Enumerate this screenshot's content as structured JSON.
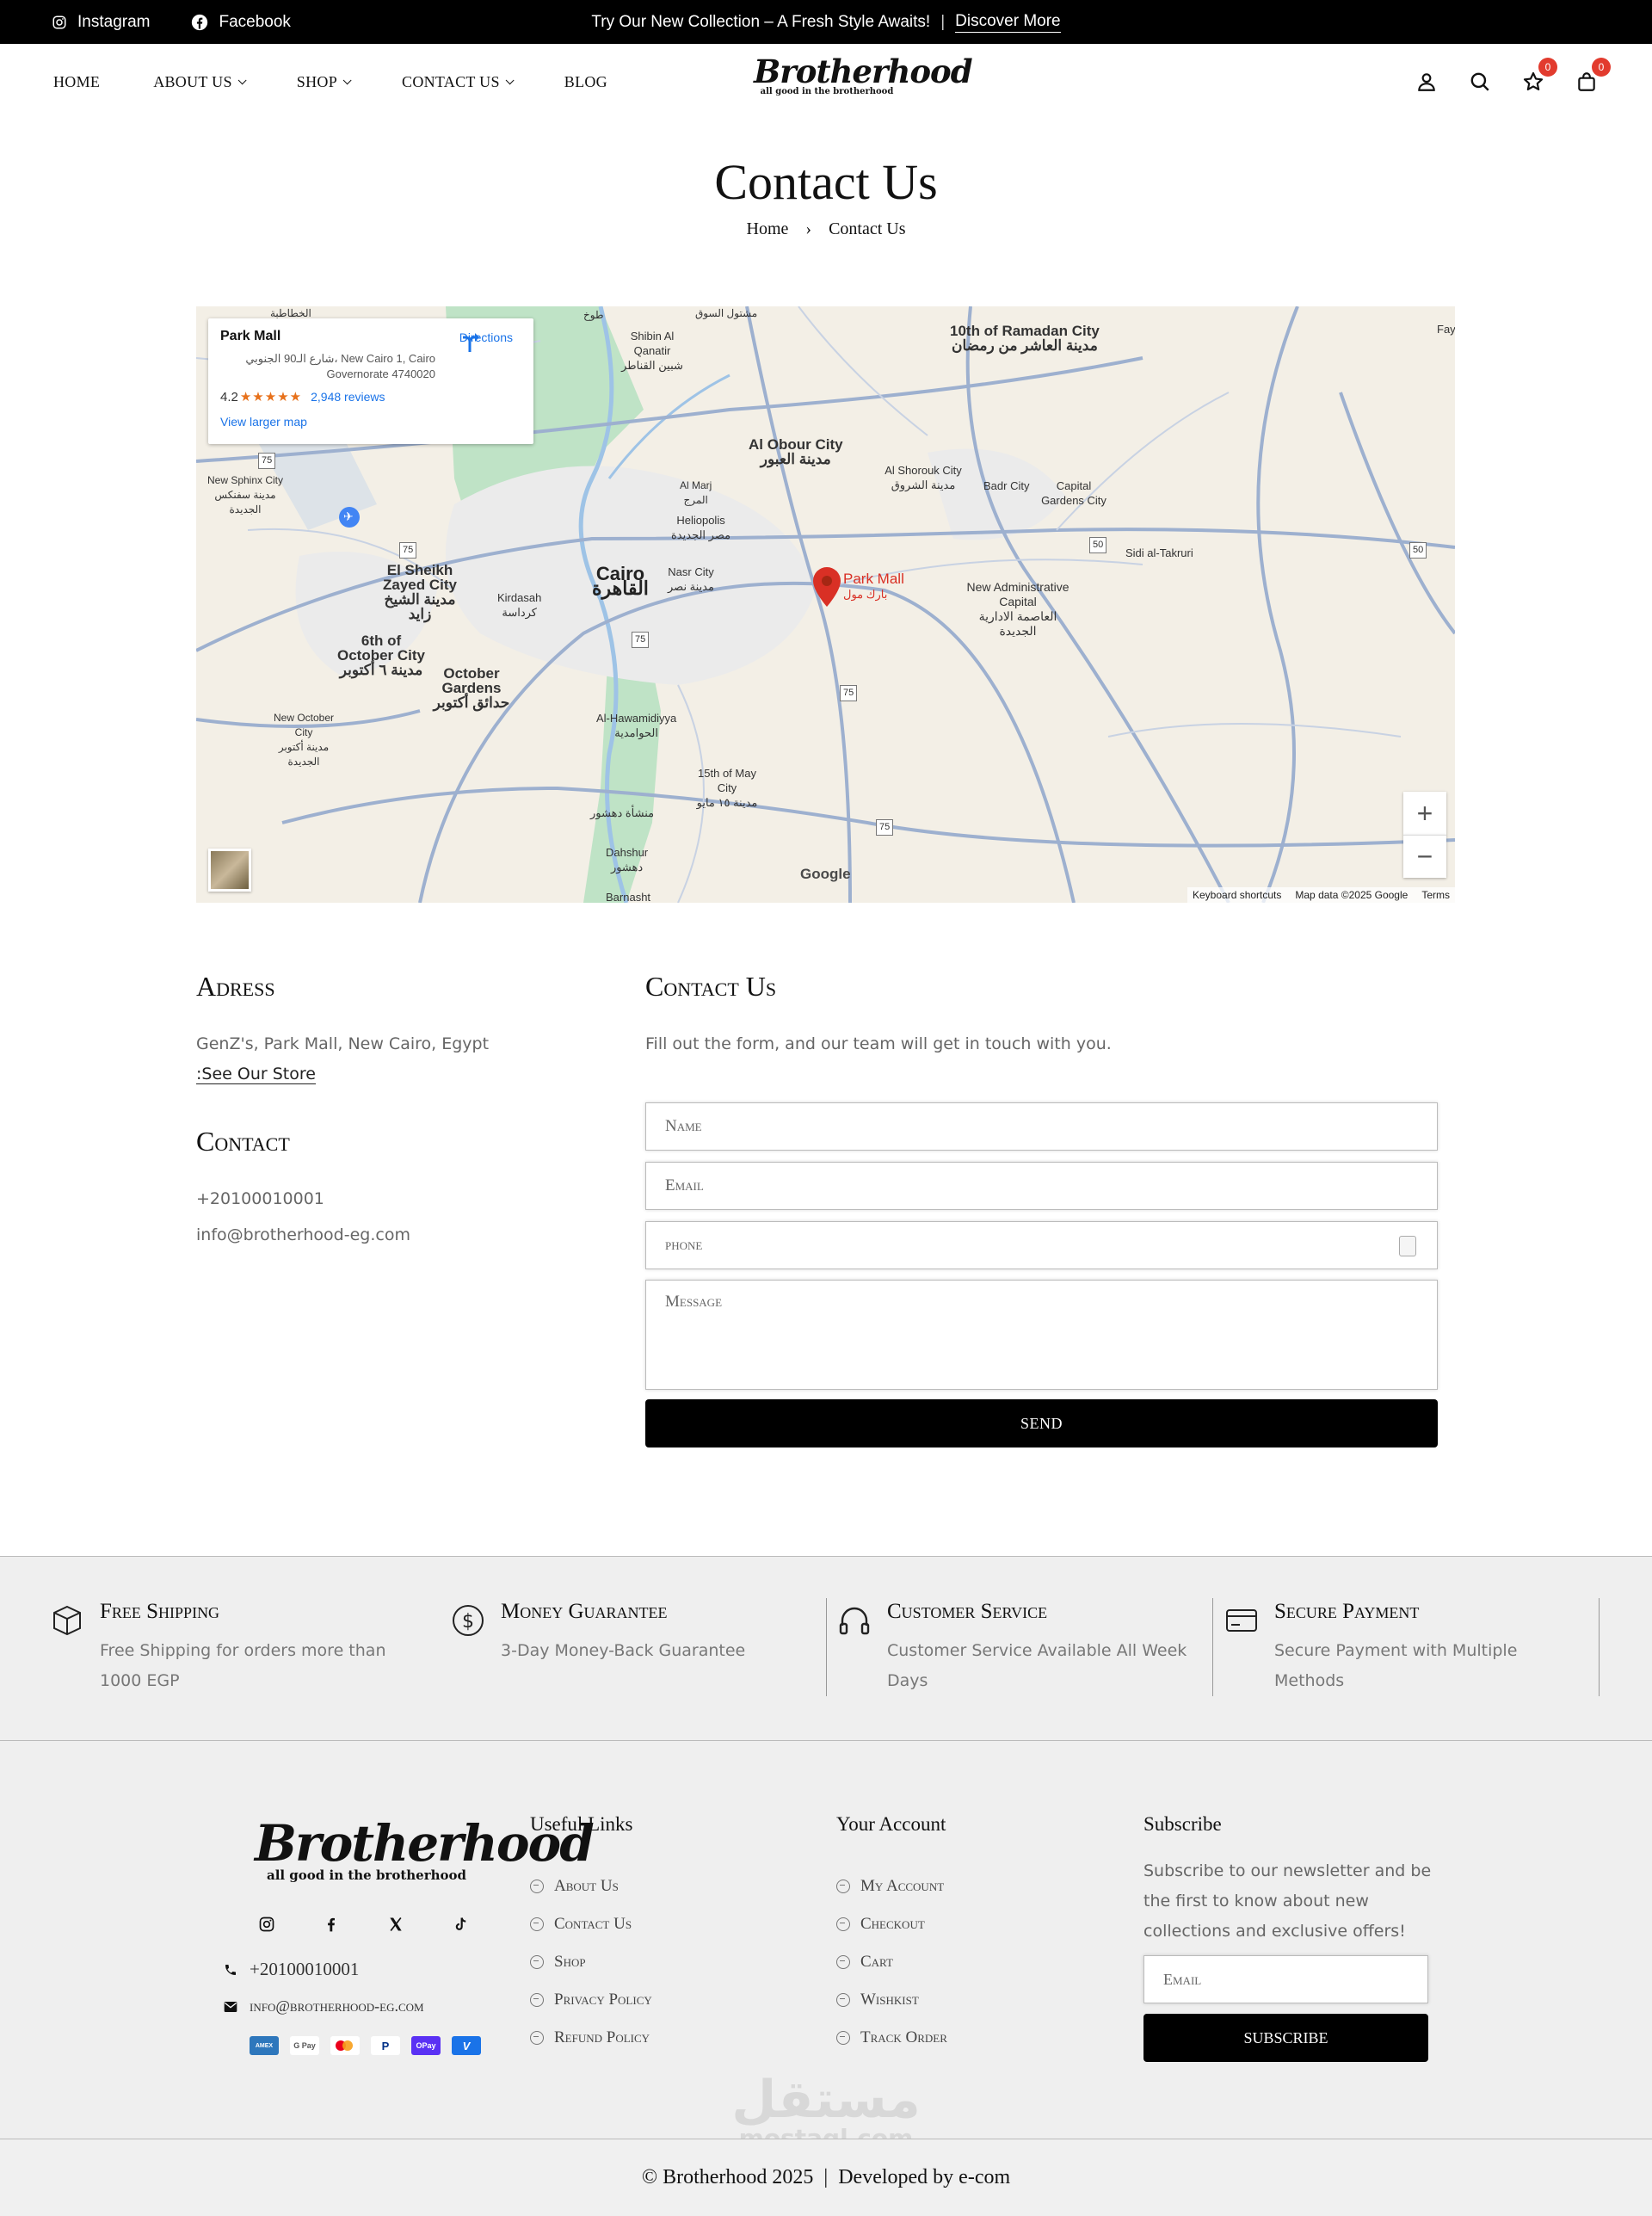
{
  "topbar": {
    "instagram": "Instagram",
    "facebook": "Facebook",
    "promo_text": "Try Our New Collection – A Fresh Style Awaits!",
    "promo_sep": "|",
    "promo_link": "Discover More"
  },
  "header": {
    "nav": [
      "HOME",
      "ABOUT US",
      "SHOP",
      "CONTACT US",
      "BLOG"
    ],
    "logo_brand": "Brotherhood",
    "logo_tag": "all good in the brotherhood",
    "wishlist_count": "0",
    "cart_count": "0"
  },
  "page": {
    "title": "Contact Us",
    "breadcrumb": [
      "Home",
      "›",
      "Contact Us"
    ]
  },
  "map": {
    "place_name": "Park Mall",
    "place_address": "شارع الـ90 الجنوبي، New Cairo 1, Cairo Governorate 4740020",
    "directions": "Directions",
    "rating": "4.2",
    "stars": "★★★★★",
    "reviews": "2,948 reviews",
    "larger_map": "View larger map",
    "marker_en": "Park Mall",
    "marker_ar": "بارك مول",
    "zoom_in": "+",
    "zoom_out": "−",
    "google": "Google",
    "keyboard": "Keyboard shortcuts",
    "map_data": "Map data ©2025 Google",
    "terms": "Terms",
    "labels": [
      "10th of Ramadan City",
      "مدينة العاشر من رمضان",
      "Al Obour City",
      "مدينة العبور",
      "Cairo",
      "القاهرة",
      "El Sheikh Zayed City",
      "مدينة الشيخ زايد",
      "6th of October City",
      "مدينة ٦ أكتوبر",
      "October Gardens",
      "حدائق أكتوبر",
      "New Administrative Capital",
      "العاصمة الادارية الجديدة",
      "Badr City",
      "Capital Gardens City",
      "Al Shorouk City",
      "مدينة الشروق",
      "Heliopolis",
      "مصر الجديدة",
      "Nasr City",
      "مدينة نصر",
      "Kirdasah",
      "كرداسة",
      "Al-Hawamidiyya",
      "الحوامدية",
      "15th of May City",
      "مدينة ١٥ مايو",
      "Sidi al-Takruri",
      "Shibin Al Qanatir",
      "شبين القناطر",
      "New Sphinx City",
      "مدينة سفنكس الجديدة",
      "New October City",
      "مدينة أكتوبر الجديدة",
      "مشتول السوق",
      "الخطاطبة",
      "طوخ",
      "Al Marj",
      "المرج",
      "منشأة دهشور",
      "Dahshur",
      "دهشور",
      "Barnasht",
      "Fay"
    ],
    "road_shields": [
      "75",
      "75",
      "75",
      "75",
      "75",
      "50",
      "50",
      "50"
    ]
  },
  "address_block": {
    "heading": "Adress",
    "line": "GenZ's, Park Mall, New Cairo, Egypt",
    "store_link": ":See Our Store"
  },
  "contact_block": {
    "heading": "Contact",
    "phone": "+20100010001",
    "email": "info@brotherhood-eg.com"
  },
  "form": {
    "heading": "Contact Us",
    "intro": "Fill out the form, and our team will get in touch with you.",
    "name_ph": "Name",
    "email_ph": "Email",
    "phone_ph": "phone",
    "message_ph": "Message",
    "send": "SEND"
  },
  "features": [
    {
      "title": "Free Shipping",
      "desc": "Free Shipping for orders more than 1000 EGP",
      "icon": "box-icon"
    },
    {
      "title": "Money Guarantee",
      "desc": "3-Day Money-Back Guarantee",
      "icon": "dollar-icon"
    },
    {
      "title": "Customer Service",
      "desc": "Customer Service Available All Week Days",
      "icon": "headphones-icon"
    },
    {
      "title": "Secure Payment",
      "desc": "Secure Payment with Multiple Methods",
      "icon": "credit-card-icon"
    }
  ],
  "footer": {
    "logo_brand": "Brotherhood",
    "logo_tag": "all good in the brotherhood",
    "phone": "+20100010001",
    "email": "info@brotherhood-eg.com",
    "payments": [
      "AMEX",
      "G Pay",
      "MC",
      "PayPal",
      "OPay",
      "V"
    ],
    "useful_links_title": "Useful Links",
    "useful_links": [
      "About Us",
      "Contact Us",
      "Shop",
      "Privacy Policy",
      "Refund Policy"
    ],
    "account_title": "Your Account",
    "account_links": [
      "My Account",
      "Checkout",
      "Cart",
      "Wishkist",
      "Track Order"
    ],
    "subscribe_title": "Subscribe",
    "subscribe_text": "Subscribe to our newsletter and be the first to know about new collections and exclusive offers!",
    "subscribe_ph": "Email",
    "subscribe_btn": "SUBSCRIBE",
    "watermark": "مستقل",
    "watermark_sub": "mostaql.com",
    "copyright": "© Brotherhood 2025",
    "copy_sep": "|",
    "developed": "Developed by e-com"
  },
  "colors": {
    "accent_black": "#000000",
    "badge_red": "#e23b2e",
    "map_marker": "#d93025",
    "map_link": "#1a73e8"
  }
}
